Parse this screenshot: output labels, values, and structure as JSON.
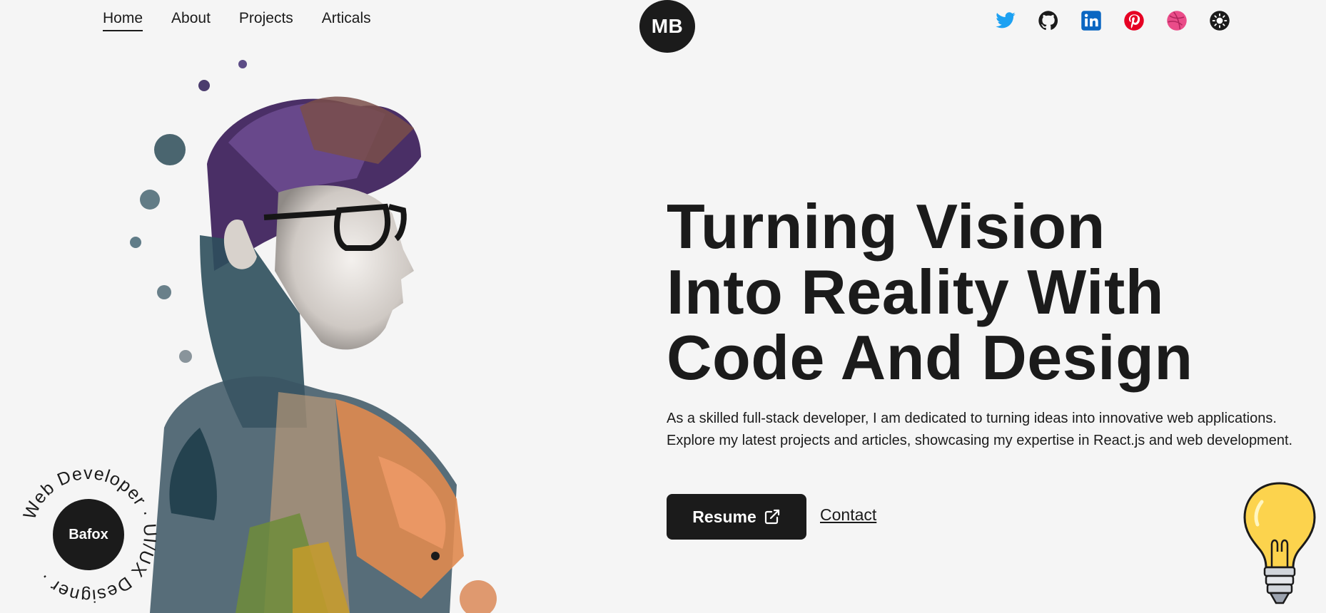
{
  "header": {
    "nav": [
      {
        "label": "Home",
        "active": true
      },
      {
        "label": "About",
        "active": false
      },
      {
        "label": "Projects",
        "active": false
      },
      {
        "label": "Articals",
        "active": false
      }
    ],
    "logo_text": "MB",
    "social_icons": [
      "twitter-icon",
      "github-icon",
      "linkedin-icon",
      "pinterest-icon",
      "dribbble-icon",
      "theme-toggle-icon"
    ]
  },
  "badge": {
    "center_text": "Bafox",
    "ring_text": "Web Developer · UI/UX Designer ·"
  },
  "hero": {
    "title_lines": [
      "Turning Vision",
      "Into Reality With",
      "Code And Design"
    ],
    "description": "As a skilled full-stack developer, I am dedicated to turning ideas into innovative web applications. Explore my latest projects and articles, showcasing my expertise in React.js and web development.",
    "resume_label": "Resume",
    "contact_label": "Contact"
  },
  "colors": {
    "background": "#f5f5f5",
    "dark": "#1b1b1b",
    "twitter": "#1da1f2",
    "linkedin": "#0a66c2",
    "pinterest": "#e60023",
    "dribbble": "#ea4c89",
    "bulb": "#fcd34d"
  }
}
